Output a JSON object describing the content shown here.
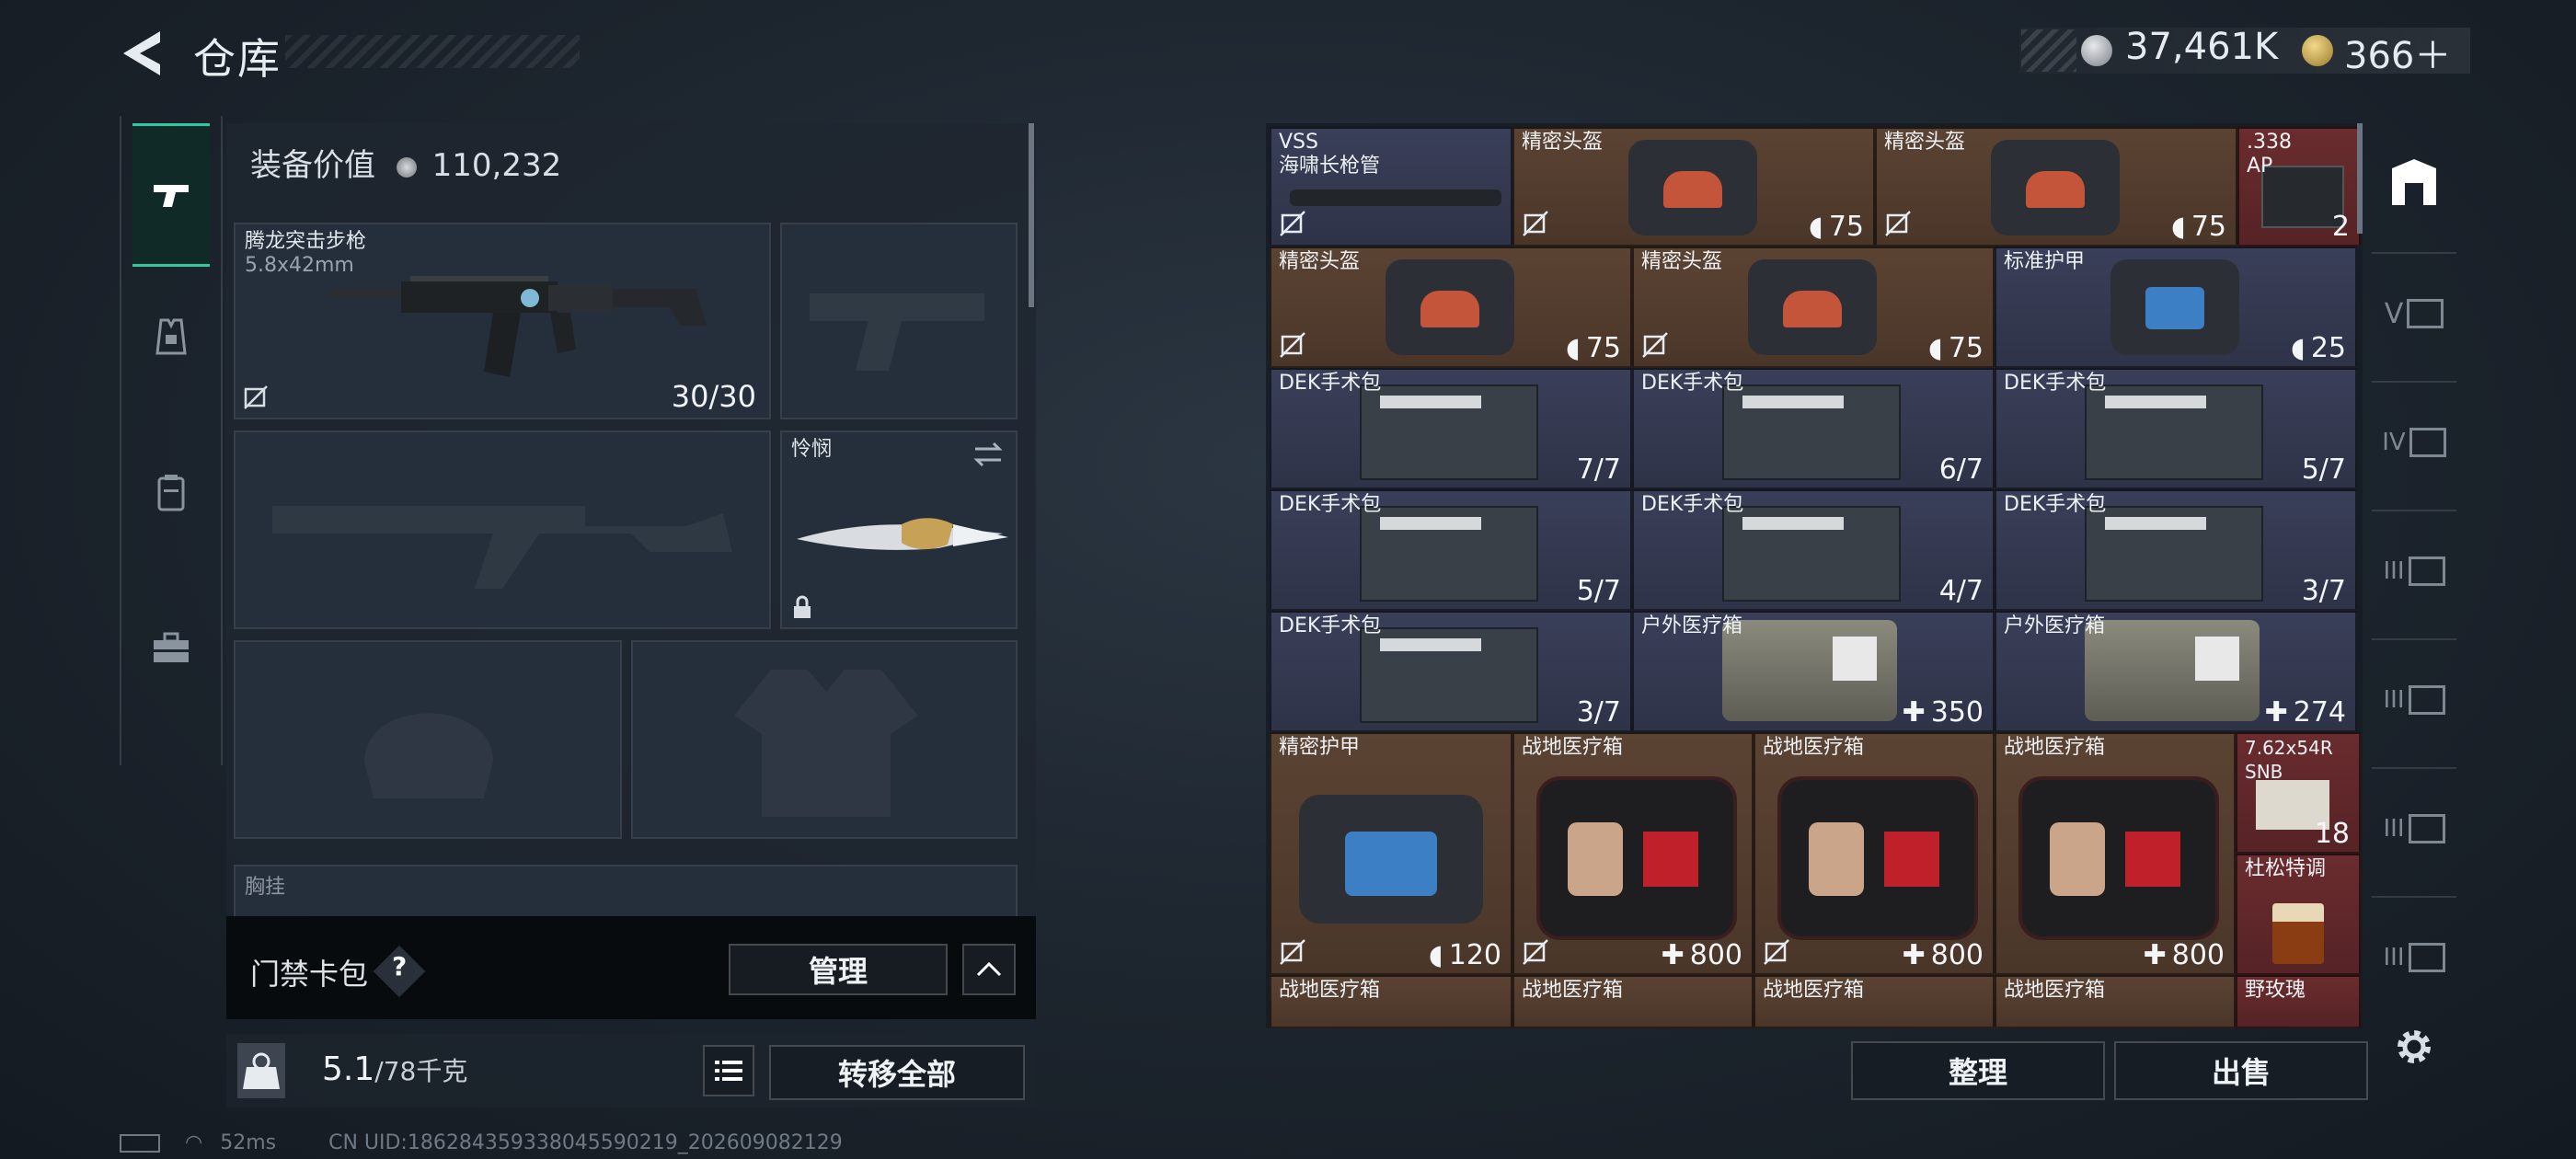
{
  "header": {
    "title": "仓库",
    "currency": [
      {
        "icon": "silver-coin-icon",
        "value": "37,461K"
      },
      {
        "icon": "gold-coin-icon",
        "value": "366＋"
      }
    ]
  },
  "left_tabs": [
    "pistol-tab-icon",
    "helmet-tab-icon",
    "backpack-tab-icon",
    "toolbox-tab-icon"
  ],
  "equipment": {
    "value_label": "装备价值",
    "value": "110,232",
    "primary": {
      "name": "腾龙突击步枪",
      "caliber": "5.8x42mm",
      "ammo": "30/30"
    },
    "melee": {
      "name": "怜悯"
    },
    "chest_label": "胸挂",
    "access_label": "门禁卡包",
    "access_help": "?",
    "manage_label": "管理",
    "weight_value": "5.1",
    "weight_max": "/78千克",
    "transfer_all_label": "转移全部"
  },
  "status": {
    "ping": "52ms",
    "uid": "CN UID:186284359338045590219_202609082129"
  },
  "inventory": {
    "row1": [
      {
        "name": "VSS",
        "name2": "海啸长枪管",
        "color": "blue"
      },
      {
        "name": "精密头盔",
        "value": "75",
        "color": "brown"
      },
      {
        "name": "精密头盔",
        "value": "75",
        "color": "brown"
      },
      {
        "name": ".338",
        "name2": "AP",
        "value": "2",
        "color": "red"
      }
    ],
    "row2": [
      {
        "name": "精密头盔",
        "value": "75",
        "color": "brown"
      },
      {
        "name": "精密头盔",
        "value": "75",
        "color": "brown"
      },
      {
        "name": "标准护甲",
        "value": "25",
        "color": "blue"
      }
    ],
    "row3": [
      {
        "name": "DEK手术包",
        "value": "7/7"
      },
      {
        "name": "DEK手术包",
        "value": "6/7"
      },
      {
        "name": "DEK手术包",
        "value": "5/7"
      }
    ],
    "row4": [
      {
        "name": "DEK手术包",
        "value": "5/7"
      },
      {
        "name": "DEK手术包",
        "value": "4/7"
      },
      {
        "name": "DEK手术包",
        "value": "3/7"
      }
    ],
    "row5": [
      {
        "name": "DEK手术包",
        "value": "3/7"
      },
      {
        "name": "户外医疗箱",
        "value": "350"
      },
      {
        "name": "户外医疗箱",
        "value": "274"
      }
    ],
    "row6": [
      {
        "name": "精密护甲",
        "value": "120"
      },
      {
        "name": "战地医疗箱",
        "value": "800"
      },
      {
        "name": "战地医疗箱",
        "value": "800"
      },
      {
        "name": "战地医疗箱",
        "value": "800"
      }
    ],
    "side": [
      {
        "name": "7.62x54R",
        "name2": "SNB",
        "value": "18"
      },
      {
        "name": "杜松特调"
      }
    ],
    "row7": [
      "战地医疗箱",
      "战地医疗箱",
      "战地医疗箱",
      "战地医疗箱",
      "野玫瑰"
    ],
    "sort_label": "整理",
    "sell_label": "出售"
  },
  "right_tabs": [
    "inventory-tab-icon",
    "V",
    "IV",
    "III",
    "III",
    "III",
    "III"
  ]
}
